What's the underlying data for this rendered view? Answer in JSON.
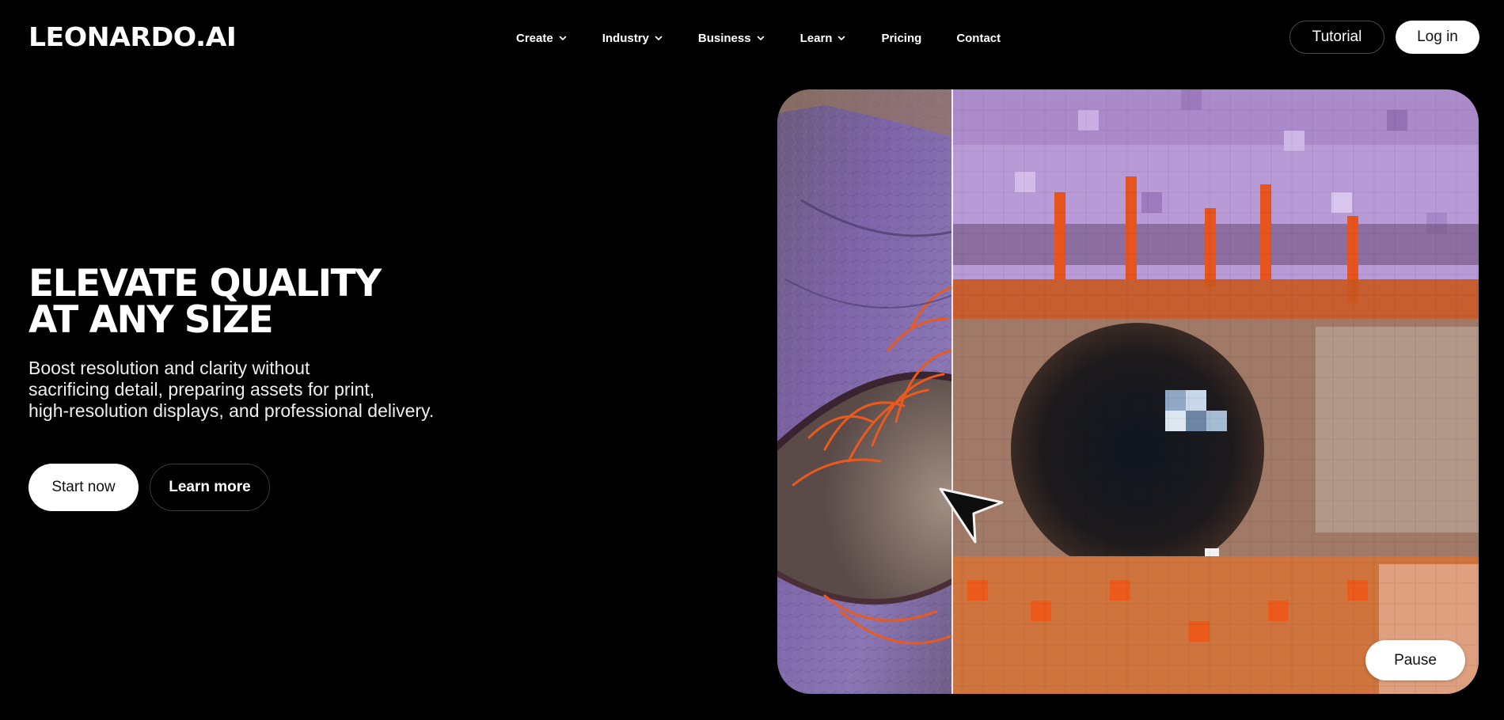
{
  "header": {
    "logo": "LEONARDO.AI",
    "nav": [
      {
        "label": "Create",
        "has_dropdown": true
      },
      {
        "label": "Industry",
        "has_dropdown": true
      },
      {
        "label": "Business",
        "has_dropdown": true
      },
      {
        "label": "Learn",
        "has_dropdown": true
      },
      {
        "label": "Pricing",
        "has_dropdown": false
      },
      {
        "label": "Contact",
        "has_dropdown": false
      }
    ],
    "tutorial_label": "Tutorial",
    "login_label": "Log in"
  },
  "hero": {
    "title_lines": [
      "ELEVATE QUALITY",
      "AT ANY SIZE"
    ],
    "description_lines": [
      "Boost resolution and clarity without",
      "sacrificing detail, preparing assets for print,",
      "high-resolution displays, and professional delivery."
    ],
    "primary_cta": "Start now",
    "secondary_cta": "Learn more"
  },
  "media": {
    "pause_label": "Pause",
    "icons": [
      "chevron-down-icon",
      "cursor-arrow-icon"
    ],
    "colors": {
      "background": "#000000",
      "eyeshadow_purple": "#8a6fb0",
      "pixel_lilac": "#b99ad8",
      "lash_orange": "#e8541e",
      "iris_dark": "#1c1a1e"
    }
  }
}
